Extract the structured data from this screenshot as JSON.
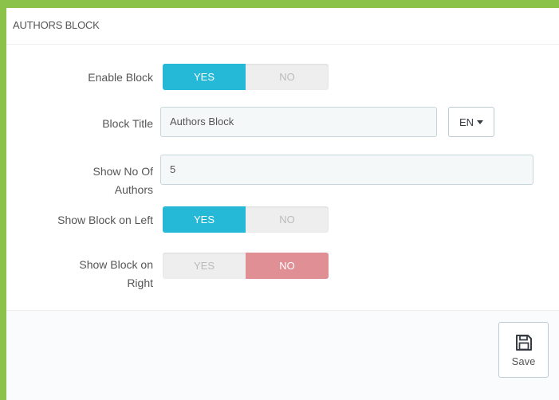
{
  "panel": {
    "title": "AUTHORS BLOCK"
  },
  "form": {
    "enable_block": {
      "label": "Enable Block",
      "yes": "YES",
      "no": "NO",
      "value": "YES"
    },
    "block_title": {
      "label": "Block Title",
      "value": "Authors Block",
      "lang": "EN"
    },
    "show_no_of_authors": {
      "label_line1": "Show No Of",
      "label_line2": "Authors",
      "value": "5"
    },
    "show_left": {
      "label": "Show Block on Left",
      "yes": "YES",
      "no": "NO",
      "value": "YES"
    },
    "show_right": {
      "label_line1": "Show Block on",
      "label_line2": "Right",
      "yes": "YES",
      "no": "NO",
      "value": "NO"
    }
  },
  "footer": {
    "save_label": "Save",
    "save_icon": "floppy-disk-icon"
  },
  "colors": {
    "accent": "#25b9d7",
    "danger": "#e08f95",
    "frame": "#8bc34a"
  }
}
